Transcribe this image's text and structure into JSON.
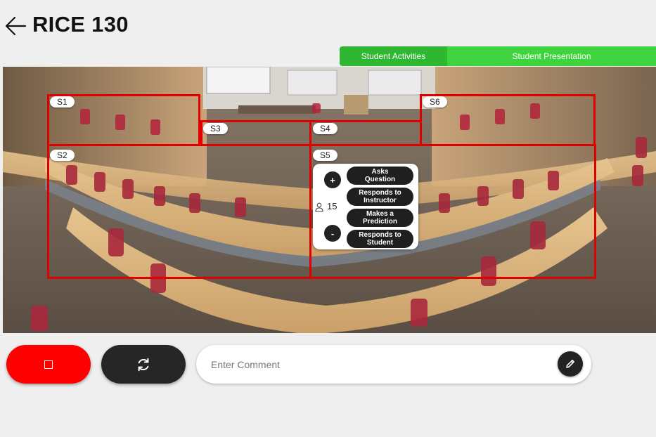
{
  "header": {
    "title": "RICE 130",
    "back_icon": "arrow-left-icon"
  },
  "tabs": [
    {
      "label": "Student Activities",
      "active": true,
      "color": "#30b732"
    },
    {
      "label": "Student Presentation",
      "active": false,
      "color": "#3fd43f"
    }
  ],
  "room": {
    "photo": "lecture-hall-panorama",
    "zone_color": "#e00000",
    "zones": [
      {
        "label": "S1"
      },
      {
        "label": "S2"
      },
      {
        "label": "S3"
      },
      {
        "label": "S4"
      },
      {
        "label": "S5"
      },
      {
        "label": "S6"
      }
    ]
  },
  "popup": {
    "increment": "+",
    "decrement": "-",
    "count": "15",
    "person_icon": "person-icon",
    "activities": [
      {
        "line1": "Asks",
        "line2": "Question"
      },
      {
        "line1": "Responds to",
        "line2": "Instructor"
      },
      {
        "line1": "Makes a",
        "line2": "Prediction"
      },
      {
        "line1": "Responds to",
        "line2": "Student"
      }
    ]
  },
  "controls": {
    "stop_icon": "stop-icon",
    "stop_color": "#ff0000",
    "refresh_icon": "refresh-icon",
    "comment_placeholder": "Enter Comment",
    "submit_icon": "pencil-icon"
  }
}
